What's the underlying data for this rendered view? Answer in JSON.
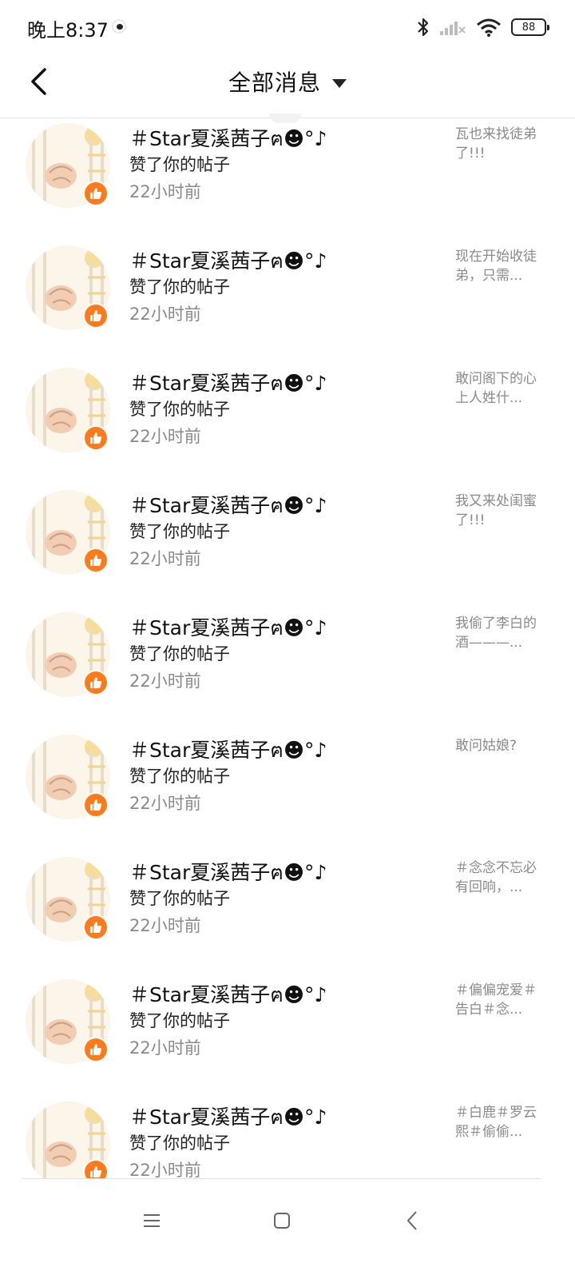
{
  "status_bar": {
    "time": "晚上8:37",
    "battery": "88"
  },
  "header": {
    "title": "全部消息"
  },
  "notifications": [
    {
      "name": "＃Star夏溪茜子ฅ☻°♪",
      "action": "赞了你的帖子",
      "time": "22小时前",
      "snippet": "瓦也来找徒弟了!!!"
    },
    {
      "name": "＃Star夏溪茜子ฅ☻°♪",
      "action": "赞了你的帖子",
      "time": "22小时前",
      "snippet": "现在开始收徒弟，只需..."
    },
    {
      "name": "＃Star夏溪茜子ฅ☻°♪",
      "action": "赞了你的帖子",
      "time": "22小时前",
      "snippet": "敢问阁下的心上人姓什..."
    },
    {
      "name": "＃Star夏溪茜子ฅ☻°♪",
      "action": "赞了你的帖子",
      "time": "22小时前",
      "snippet": "我又来处闺蜜了!!!"
    },
    {
      "name": "＃Star夏溪茜子ฅ☻°♪",
      "action": "赞了你的帖子",
      "time": "22小时前",
      "snippet": "我偷了李白的酒———..."
    },
    {
      "name": "＃Star夏溪茜子ฅ☻°♪",
      "action": "赞了你的帖子",
      "time": "22小时前",
      "snippet": "敢问姑娘?"
    },
    {
      "name": "＃Star夏溪茜子ฅ☻°♪",
      "action": "赞了你的帖子",
      "time": "22小时前",
      "snippet": "＃念念不忘必有回响，..."
    },
    {
      "name": "＃Star夏溪茜子ฅ☻°♪",
      "action": "赞了你的帖子",
      "time": "22小时前",
      "snippet": "＃偏偏宠爱＃告白＃念..."
    },
    {
      "name": "＃Star夏溪茜子ฅ☻°♪",
      "action": "赞了你的帖子",
      "time": "22小时前",
      "snippet": "＃白鹿＃罗云熙＃偷偷..."
    }
  ],
  "colors": {
    "like_badge": "#ff7a1a",
    "secondary_text": "#8a8a8a"
  },
  "icons": {
    "back": "back-arrow-icon",
    "dropdown": "caret-down-icon",
    "like": "thumbs-up-icon",
    "nav_menu": "menu-icon",
    "nav_home": "home-square-icon",
    "nav_back": "nav-back-icon"
  }
}
